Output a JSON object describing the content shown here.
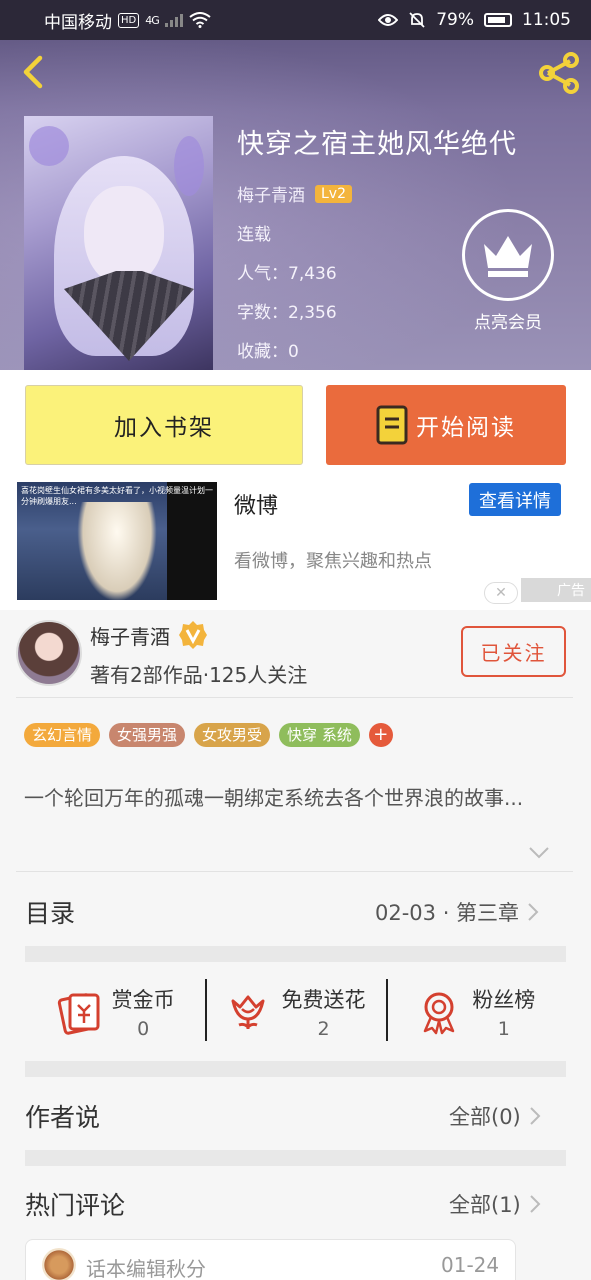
{
  "status_bar": {
    "carrier": "中国移动",
    "hd": "HD",
    "network": "4G",
    "battery": "79%",
    "time": "11:05"
  },
  "book": {
    "title": "快穿之宿主她风华绝代",
    "author": "梅子青酒",
    "level": "Lv2",
    "status": "连载",
    "popularity": "人气：7,436",
    "word_count": "字数：2,356",
    "favorites": "收藏：0"
  },
  "vip": {
    "label": "点亮会员"
  },
  "actions": {
    "add_shelf": "加入书架",
    "start_reading": "开始阅读"
  },
  "ad": {
    "image_caption": "喜花岗壁生仙女裙有多美太好看了，小视频量温计划一分钟刷爆朋友...",
    "title": "微博",
    "button": "查看详情",
    "description": "看微博，聚焦兴趣和热点",
    "close": "✕",
    "tag": "广告"
  },
  "author_card": {
    "name": "梅子青酒",
    "stats": "著有2部作品·125人关注",
    "follow": "已关注"
  },
  "tags": [
    {
      "label": "玄幻言情",
      "color": "#f3a93c"
    },
    {
      "label": "女强男强",
      "color": "#c8866e"
    },
    {
      "label": "女攻男受",
      "color": "#d8a44a"
    },
    {
      "label": "快穿  系统",
      "color": "#8fbd5c"
    }
  ],
  "tag_more": "+",
  "summary": "一个轮回万年的孤魂一朝绑定系统去各个世界浪的故事...",
  "toc": {
    "title": "目录",
    "latest": "02-03 · 第三章"
  },
  "stats": [
    {
      "icon": "red-envelope-icon",
      "label": "赏金币",
      "value": "0"
    },
    {
      "icon": "flower-icon",
      "label": "免费送花",
      "value": "2"
    },
    {
      "icon": "medal-icon",
      "label": "粉丝榜",
      "value": "1"
    }
  ],
  "author_says": {
    "title": "作者说",
    "all": "全部(0)"
  },
  "hot_comments": {
    "title": "热门评论",
    "all": "全部(1)"
  },
  "comment": {
    "user": "话本编辑秋分",
    "date": "01-24"
  },
  "colors": {
    "accent": "#ea6b3d",
    "shelf_button": "#fbf27a",
    "follow": "#e0553b",
    "ad_button": "#1e6fd9",
    "level_badge": "#f3b43c"
  }
}
